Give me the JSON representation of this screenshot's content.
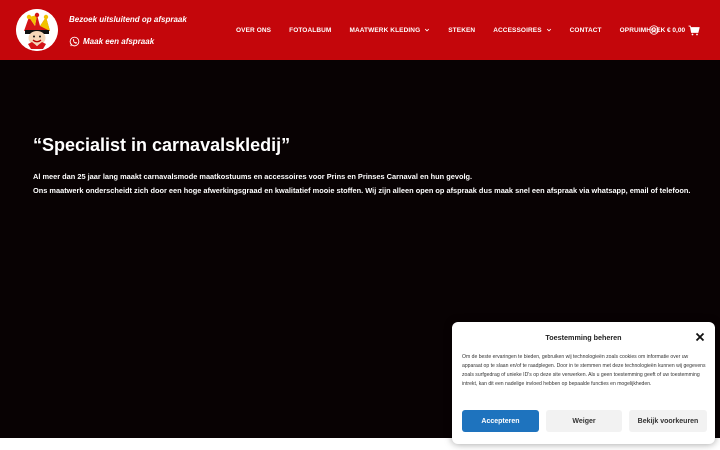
{
  "header": {
    "tagline": "Bezoek uitsluitend op afspraak",
    "whatsapp_label": "Maak een afspraak",
    "logo_icon": "jester-logo-icon",
    "background_color": "#c4060b"
  },
  "nav": {
    "items": [
      {
        "label": "OVER ONS",
        "has_dropdown": false
      },
      {
        "label": "FOTOALBUM",
        "has_dropdown": false
      },
      {
        "label": "MAATWERK KLEDING",
        "has_dropdown": true
      },
      {
        "label": "STEKEN",
        "has_dropdown": false
      },
      {
        "label": "ACCESSOIRES",
        "has_dropdown": true
      },
      {
        "label": "CONTACT",
        "has_dropdown": false
      },
      {
        "label": "OPRUIMHOEK",
        "has_dropdown": false
      }
    ],
    "account_icon": "account-icon",
    "cart_price": "€ 0,00",
    "cart_icon": "cart-icon"
  },
  "hero": {
    "title": "“Specialist in carnavalskledij”",
    "line1": "Al meer dan 25 jaar lang maakt carnavalsmode maatkostuums en accessoires voor Prins en Prinses Carnaval en hun gevolg.",
    "line2": "Ons maatwerk onderscheidt zich door een hoge afwerkingsgraad en kwalitatief mooie stoffen. Wij zijn alleen open op afspraak dus maak snel een afspraak via whatsapp, email of telefoon."
  },
  "consent": {
    "title": "Toestemming beheren",
    "text": "Om de beste ervaringen te bieden, gebruiken wij technologieën zoals cookies om informatie over uw apparaat op te slaan en/of te raadplegen. Door in te stemmen met deze technologieën kunnen wij gegevens zoals surfgedrag of unieke ID's op deze site verwerken. Als u geen toestemming geeft of uw toestemming intrekt, kan dit een nadelige invloed hebben op bepaalde functies en mogelijkheden.",
    "accept_label": "Accepteren",
    "deny_label": "Weiger",
    "prefs_label": "Bekijk voorkeuren",
    "accent_color": "#1e73be"
  }
}
